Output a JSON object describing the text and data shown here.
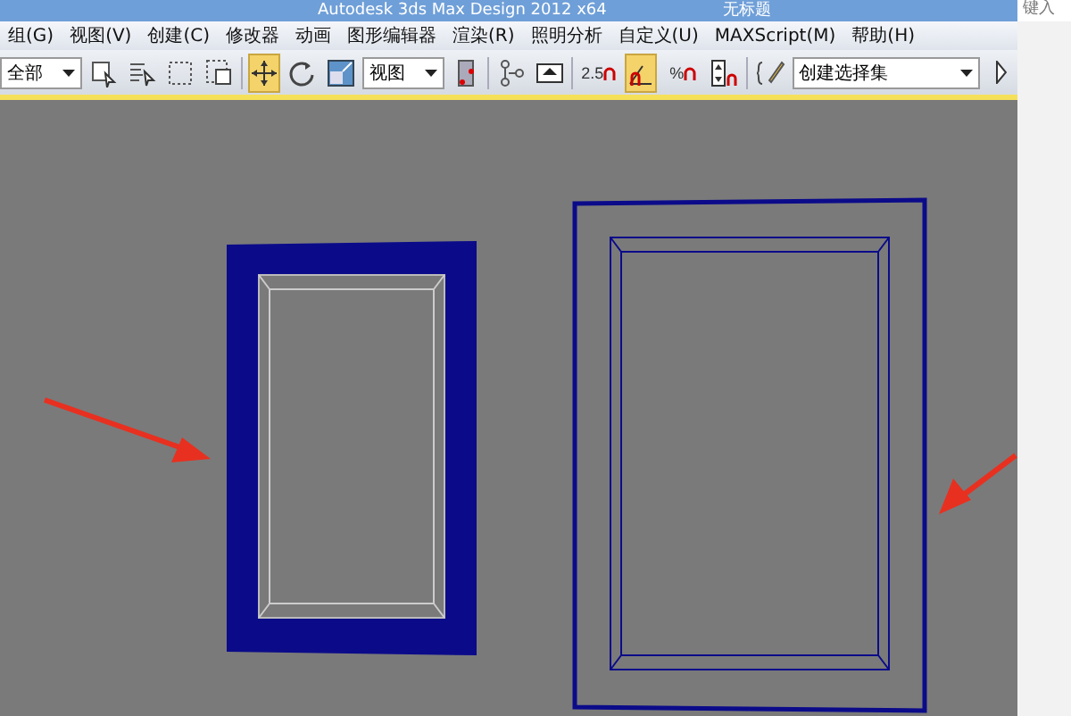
{
  "window": {
    "title": "Autodesk 3ds Max Design 2012 x64",
    "document": "无标题",
    "search": {
      "placeholder": "键入"
    }
  },
  "menu": [
    {
      "label": "组(G)"
    },
    {
      "label": "视图(V)"
    },
    {
      "label": "创建(C)"
    },
    {
      "label": "修改器"
    },
    {
      "label": "动画"
    },
    {
      "label": "图形编辑器"
    },
    {
      "label": "渲染(R)"
    },
    {
      "label": "照明分析"
    },
    {
      "label": "自定义(U)"
    },
    {
      "label": "MAXScript(M)"
    },
    {
      "label": "帮助(H)"
    }
  ],
  "toolbar": [
    {
      "kind": "dropdown",
      "value": "全部"
    },
    {
      "kind": "select-object",
      "selected": false
    },
    {
      "kind": "select-by-name",
      "selected": false
    },
    {
      "kind": "rect-region",
      "selected": false
    },
    {
      "kind": "window-crossing",
      "selected": false
    },
    {
      "kind": "separator"
    },
    {
      "kind": "move",
      "selected": true
    },
    {
      "kind": "rotate",
      "selected": false
    },
    {
      "kind": "scale",
      "selected": false
    },
    {
      "kind": "dropdown",
      "value": "视图"
    },
    {
      "kind": "pivot",
      "selected": false
    },
    {
      "kind": "separator"
    },
    {
      "kind": "link",
      "selected": false
    },
    {
      "kind": "manipulate",
      "selected": false
    },
    {
      "kind": "separator"
    },
    {
      "kind": "snap",
      "value": "2.5",
      "selected": false
    },
    {
      "kind": "angle-snap",
      "selected": true
    },
    {
      "kind": "snap",
      "value": "%",
      "selected": false
    },
    {
      "kind": "spinner-snap",
      "selected": false
    },
    {
      "kind": "separator"
    },
    {
      "kind": "edit-named",
      "selected": false
    },
    {
      "kind": "dropdown",
      "value": "创建选择集"
    },
    {
      "kind": "mirror",
      "selected": false
    }
  ],
  "viewport": {
    "objects": [
      {
        "kind": "frame",
        "selected": true
      },
      {
        "kind": "frame",
        "selected": false
      }
    ]
  }
}
